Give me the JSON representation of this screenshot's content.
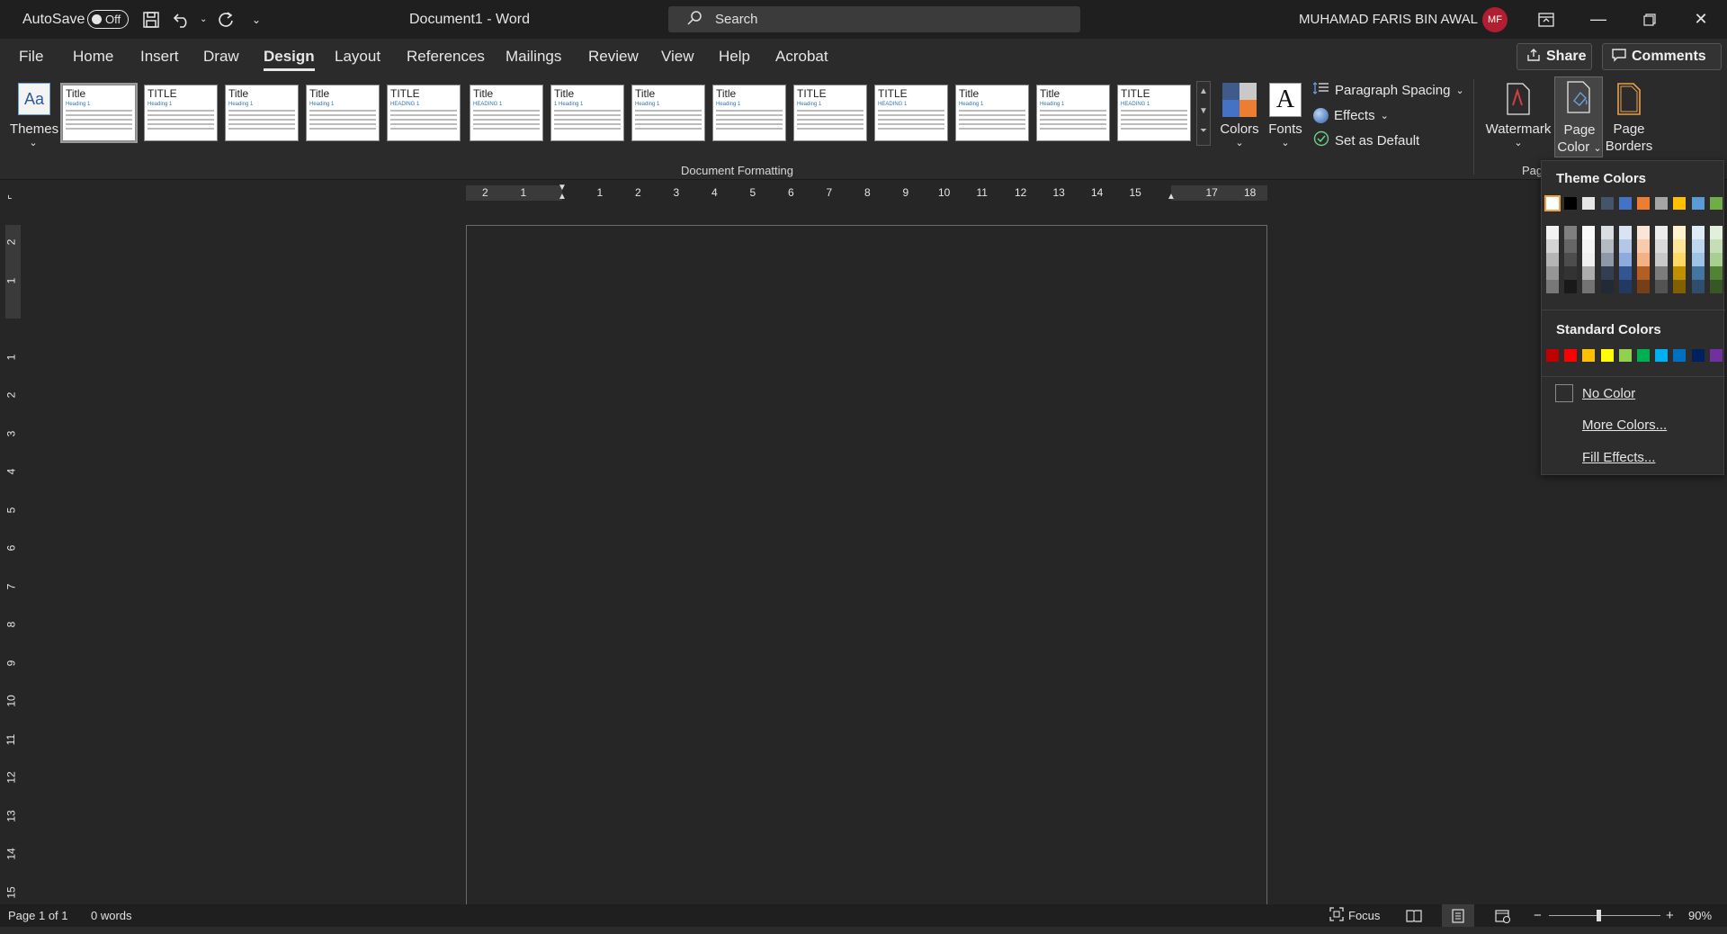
{
  "titlebar": {
    "autosave_label": "AutoSave",
    "autosave_state": "Off",
    "document_title": "Document1  -  Word",
    "search_placeholder": "Search",
    "user_name": "MUHAMAD FARIS BIN AWAL",
    "user_initials": "MF"
  },
  "menu": {
    "items": [
      "File",
      "Home",
      "Insert",
      "Draw",
      "Design",
      "Layout",
      "References",
      "Mailings",
      "Review",
      "View",
      "Help",
      "Acrobat"
    ],
    "active": "Design",
    "share_label": "Share",
    "comments_label": "Comments"
  },
  "ribbon": {
    "themes_label": "Themes",
    "style_thumbs": [
      {
        "title": "Title",
        "heading": "Heading 1"
      },
      {
        "title": "TITLE",
        "heading": "Heading 1"
      },
      {
        "title": "Title",
        "heading": "Heading 1"
      },
      {
        "title": "Title",
        "heading": "Heading 1"
      },
      {
        "title": "TITLE",
        "heading": "HEADING 1"
      },
      {
        "title": "Title",
        "heading": "HEADING 1"
      },
      {
        "title": "Title",
        "heading": "1 Heading 1"
      },
      {
        "title": "Title",
        "heading": "Heading 1"
      },
      {
        "title": "Title",
        "heading": "Heading 1"
      },
      {
        "title": "TITLE",
        "heading": "Heading 1"
      },
      {
        "title": "TITLE",
        "heading": "HEADING 1"
      },
      {
        "title": "Title",
        "heading": "Heading 1"
      },
      {
        "title": "Title",
        "heading": "Heading 1"
      },
      {
        "title": "TITLE",
        "heading": "HEADING 1"
      }
    ],
    "colors_label": "Colors",
    "fonts_label": "Fonts",
    "paragraph_spacing_label": "Paragraph Spacing",
    "effects_label": "Effects",
    "set_default_label": "Set as Default",
    "group_label": "Document Formatting",
    "watermark_label": "Watermark",
    "page_color_line1": "Page",
    "page_color_line2": "Color",
    "page_borders_line1": "Page",
    "page_borders_line2": "Borders",
    "page_bg_group_label": "Pag"
  },
  "ruler": {
    "h_left": [
      "2",
      "1"
    ],
    "h_right": [
      "1",
      "2",
      "3",
      "4",
      "5",
      "6",
      "7",
      "8",
      "9",
      "10",
      "11",
      "12",
      "13",
      "14",
      "15",
      "17",
      "18"
    ],
    "v_top": [
      "2",
      "1"
    ],
    "v_bottom": [
      "1",
      "2",
      "3",
      "4",
      "5",
      "6",
      "7",
      "8",
      "9",
      "10",
      "11",
      "12",
      "13",
      "14",
      "15"
    ]
  },
  "page_color_dropdown": {
    "theme_colors_label": "Theme Colors",
    "theme_colors": [
      "#FFFFFF",
      "#000000",
      "#E7E6E6",
      "#44546A",
      "#4472C4",
      "#ED7D31",
      "#A5A5A5",
      "#FFC000",
      "#5B9BD5",
      "#70AD47"
    ],
    "standard_colors_label": "Standard Colors",
    "standard_colors": [
      "#C00000",
      "#FF0000",
      "#FFC000",
      "#FFFF00",
      "#92D050",
      "#00B050",
      "#00B0F0",
      "#0070C0",
      "#002060",
      "#7030A0"
    ],
    "no_color_label": "No Color",
    "more_colors_label": "More Colors...",
    "fill_effects_label": "Fill Effects..."
  },
  "status": {
    "page_info": "Page 1 of 1",
    "word_count": "0 words",
    "focus_label": "Focus",
    "zoom": "90%"
  }
}
